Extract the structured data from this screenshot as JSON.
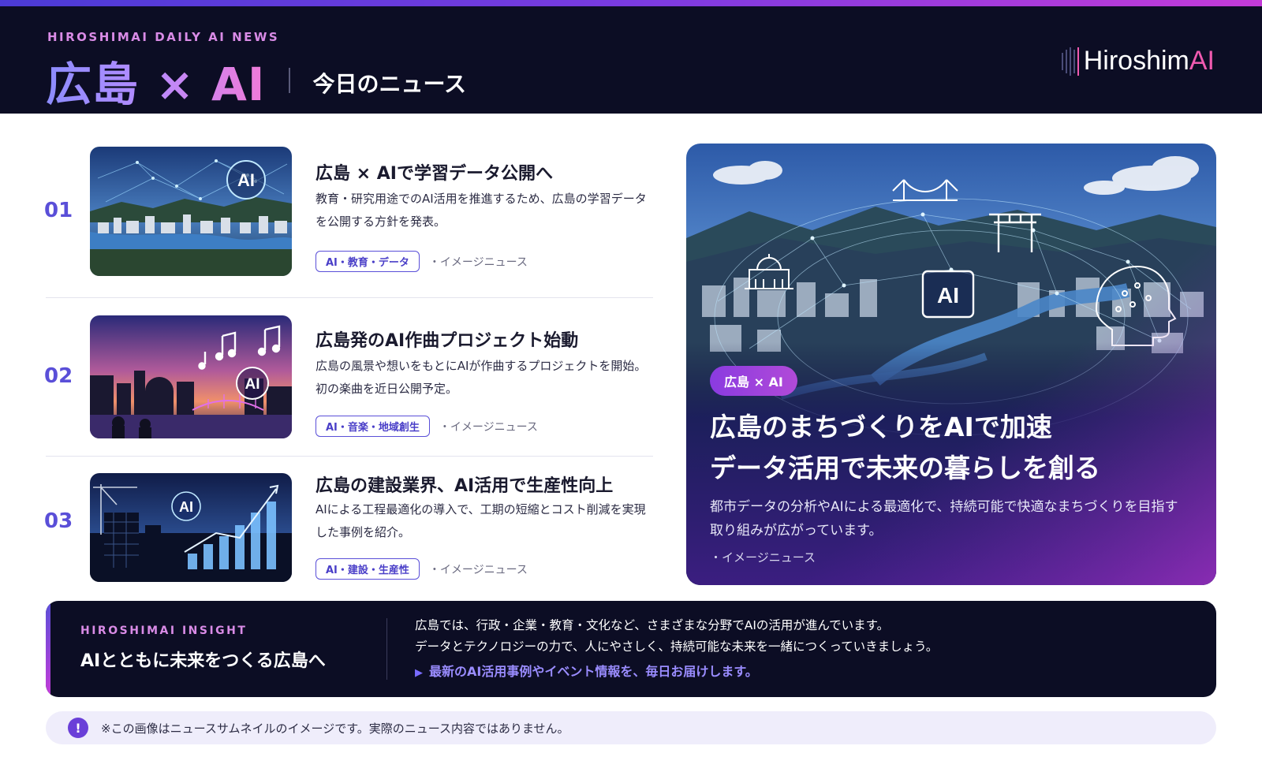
{
  "header": {
    "kicker": "HIROSHIMAI DAILY AI NEWS",
    "title": "広島 × AI",
    "subtitle": "今日のニュース",
    "logo_main": "Hiroshim",
    "logo_accent": "AI"
  },
  "news": [
    {
      "num": "01",
      "title": "広島 × AIで学習データ公開へ",
      "desc": "教育・研究用途でのAI活用を推進するため、広島の学習データを公開する方針を発表。",
      "tag": "AI・教育・データ",
      "source": "・イメージニュース",
      "thumb_badge": "AI"
    },
    {
      "num": "02",
      "title": "広島発のAI作曲プロジェクト始動",
      "desc": "広島の風景や想いをもとにAIが作曲するプロジェクトを開始。初の楽曲を近日公開予定。",
      "tag": "AI・音楽・地域創生",
      "source": "・イメージニュース",
      "thumb_badge": "AI"
    },
    {
      "num": "03",
      "title": "広島の建設業界、AI活用で生産性向上",
      "desc": "AIによる工程最適化の導入で、工期の短縮とコスト削減を実現した事例を紹介。",
      "tag": "AI・建設・生産性",
      "source": "・イメージニュース",
      "thumb_badge": "AI"
    }
  ],
  "feature": {
    "pill": "広島 × AI",
    "title_line1": "広島のまちづくりをAIで加速",
    "title_line2": "データ活用で未来の暮らしを創る",
    "desc": "都市データの分析やAIによる最適化で、持続可能で快適なまちづくりを目指す取り組みが広がっています。",
    "source": "・イメージニュース",
    "badge": "AI"
  },
  "insight": {
    "kicker": "HIROSHIMAI INSIGHT",
    "title": "AIとともに未来をつくる広島へ",
    "body_line1": "広島では、行政・企業・教育・文化など、さまざまな分野でAIの活用が進んでいます。",
    "body_line2": "データとテクノロジーの力で、人にやさしく、持続可能な未来を一緒につくっていきましょう。",
    "link": "最新のAI活用事例やイベント情報を、毎日お届けします。"
  },
  "notice": {
    "icon": "!",
    "text": "※この画像はニュースサムネイルのイメージです。実際のニュース内容ではありません。"
  },
  "colors": {
    "header_bg": "#0c0d24",
    "accent_purple": "#5a4fd8",
    "accent_pink": "#f05ab0",
    "notice_bg": "#efedfb"
  }
}
